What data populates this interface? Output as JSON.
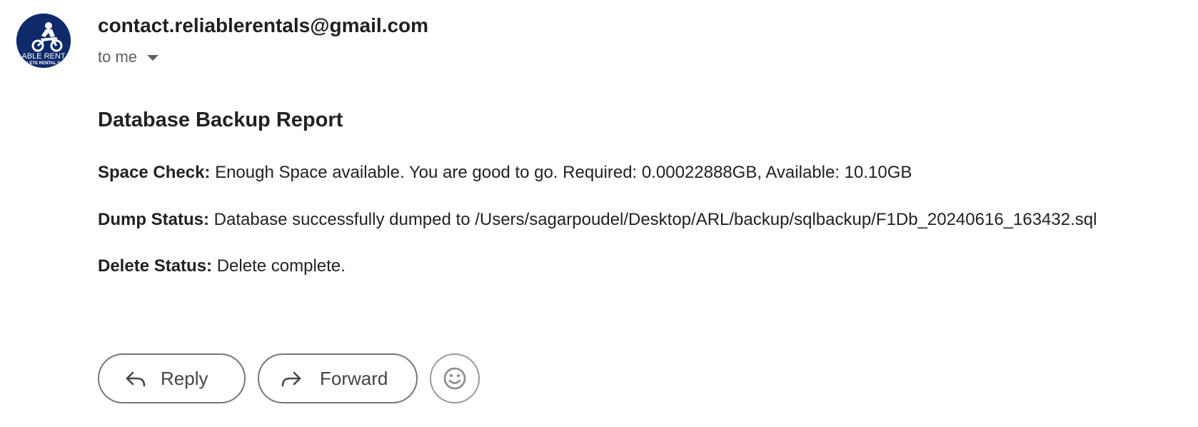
{
  "sender": {
    "email": "contact.reliablerentals@gmail.com",
    "recipient_label": "to me",
    "avatar": {
      "icon": "dirt-bike-rider-icon",
      "text_line1": "ABLE RENT",
      "text_line2": "LETE RENTAL S",
      "background": "#0f2a6b"
    }
  },
  "message": {
    "title": "Database Backup Report",
    "lines": [
      {
        "key": "Space Check:",
        "value": "Enough Space available. You are good to go. Required: 0.00022888GB, Available: 10.10GB"
      },
      {
        "key": "Dump Status:",
        "value": "Database successfully dumped to /Users/sagarpoudel/Desktop/ARL/backup/sqlbackup/F1Db_20240616_163432.sql"
      },
      {
        "key": "Delete Status:",
        "value": "Delete complete."
      }
    ]
  },
  "actions": {
    "reply_label": "Reply",
    "forward_label": "Forward",
    "reply_icon": "reply-arrow-icon",
    "forward_icon": "forward-arrow-icon",
    "emoji_icon": "smiley-face-icon"
  },
  "colors": {
    "text": "#1f1f1f",
    "muted": "#5e5e5e",
    "button_border": "#747775"
  }
}
